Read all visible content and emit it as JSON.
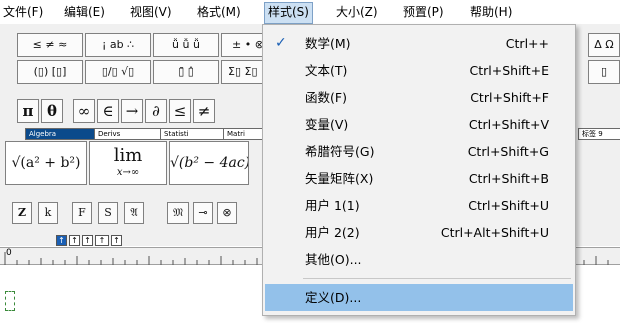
{
  "menubar": {
    "items": [
      {
        "label": "文件(F)"
      },
      {
        "label": "编辑(E)"
      },
      {
        "label": "视图(V)"
      },
      {
        "label": "格式(M)"
      },
      {
        "label": "样式(S)"
      },
      {
        "label": "大小(Z)"
      },
      {
        "label": "预置(P)"
      },
      {
        "label": "帮助(H)"
      }
    ]
  },
  "toolbar": {
    "row1": [
      "≤ ≠ ≈",
      "¡ ab ∴",
      "ǚ ǚ ǚ",
      "± • ⊗"
    ],
    "row2": [
      "(▯) [▯]",
      "▯/▯ √▯",
      "▯̄ ▯̂",
      "Σ▯ Σ▯"
    ],
    "symbols": [
      "π",
      "θ",
      "∞",
      "∈",
      "→",
      "∂",
      "≤",
      "≠"
    ],
    "tabs": [
      "Algebra",
      "Derivs",
      "Statisti",
      "Matri"
    ],
    "right_label": "标签 9",
    "templates": {
      "sqrt_sum": "√(a² + b²)",
      "lim_top": "lim",
      "lim_bottom": "x→∞",
      "sqrt_disc": "√(b² − 4ac)"
    },
    "row_bottom": [
      "Z",
      "k",
      "F",
      "S",
      "𝔄",
      "𝔐",
      "⊸",
      "⊗"
    ],
    "right_top": "Δ Ω",
    "right_bottom": "▯"
  },
  "ruler": {
    "zero_label": "0"
  },
  "style_menu": {
    "items": [
      {
        "label": "数学(M)",
        "shortcut": "Ctrl++",
        "checked": true
      },
      {
        "label": "文本(T)",
        "shortcut": "Ctrl+Shift+E"
      },
      {
        "label": "函数(F)",
        "shortcut": "Ctrl+Shift+F"
      },
      {
        "label": "变量(V)",
        "shortcut": "Ctrl+Shift+V"
      },
      {
        "label": "希腊符号(G)",
        "shortcut": "Ctrl+Shift+G"
      },
      {
        "label": "矢量矩阵(X)",
        "shortcut": "Ctrl+Shift+B"
      },
      {
        "label": "用户 1(1)",
        "shortcut": "Ctrl+Shift+U"
      },
      {
        "label": "用户 2(2)",
        "shortcut": "Ctrl+Alt+Shift+U"
      },
      {
        "label": "其他(O)...",
        "shortcut": ""
      },
      {
        "label": "定义(D)...",
        "shortcut": "",
        "highlighted": true
      }
    ],
    "check_glyph": "✓"
  }
}
